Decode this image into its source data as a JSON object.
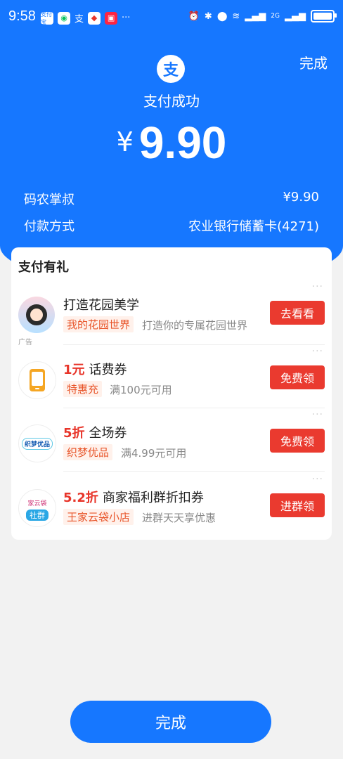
{
  "status_bar": {
    "time": "9:58",
    "app_icons": [
      "支付宝",
      "微信",
      "支",
      "支付宝",
      "小红书"
    ],
    "more": "···",
    "signal_label": "2G"
  },
  "header": {
    "done_label": "完成",
    "logo_glyph": "支",
    "title": "支付成功",
    "currency": "¥",
    "amount": "9.90"
  },
  "info": {
    "payee_label": "码农掌叔",
    "payee_amount": "¥9.90",
    "method_label": "付款方式",
    "method_value": "农业银行储蓄卡(4271)"
  },
  "gift_card": {
    "title": "支付有礼",
    "items": [
      {
        "title": "打造花园美学",
        "highlight": "",
        "tag": "我的花园世界",
        "desc": "打造你的专属花园世界",
        "button": "去看看",
        "ad_label": "广告",
        "icon": "garden-avatar-icon"
      },
      {
        "title": "话费券",
        "highlight": "1元",
        "tag": "特惠充",
        "desc": "满100元可用",
        "button": "免费领",
        "icon": "phone-icon"
      },
      {
        "title": "全场券",
        "highlight": "5折",
        "tag": "织梦优品",
        "desc": "满4.99元可用",
        "button": "免费领",
        "icon": "zhimeng-logo-icon",
        "logo_text": "织梦优品"
      },
      {
        "title": "商家福利群折扣券",
        "highlight": "5.2折",
        "tag": "王家云袋小店",
        "desc": "进群天天享优惠",
        "button": "进群领",
        "icon": "shequn-icon",
        "logo_top": "家云袋",
        "logo_badge": "社群"
      }
    ]
  },
  "footer": {
    "done_label": "完成"
  },
  "colors": {
    "primary": "#1677ff",
    "accent_red": "#ea3a2f",
    "tag_orange": "#e8552a"
  }
}
